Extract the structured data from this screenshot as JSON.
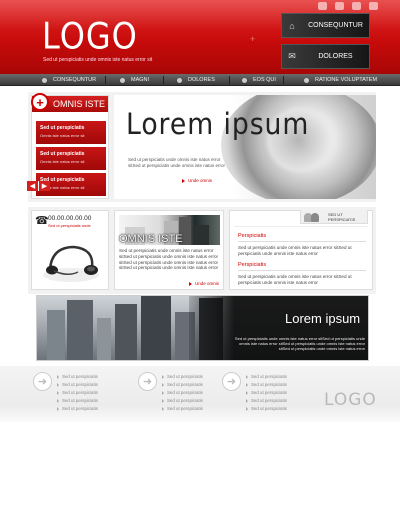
{
  "header": {
    "logo": "LOGO",
    "tagline": "Sed ut perspiciatis unde omnis iste natus error sit",
    "buttons": [
      {
        "label": "CONSEQUNTUR",
        "icon": "home-icon"
      },
      {
        "label": "DOLORES",
        "icon": "mail-icon"
      }
    ],
    "social_icons": [
      "share-icon",
      "rss-icon",
      "twitter-icon",
      "facebook-icon"
    ]
  },
  "nav": {
    "items": [
      "CONSEQUNTUR",
      "MAGNI",
      "DOLORES",
      "EOS QUI",
      "RATIONE VOLUPTATEM"
    ]
  },
  "sidebar_box": {
    "title": "OMNIS ISTE",
    "items": [
      {
        "title": "Sed ut perspiciatis",
        "sub": "Omnis iste natus error sit"
      },
      {
        "title": "Sed ut perspiciatis",
        "sub": "Omnis iste natus error sit"
      },
      {
        "title": "Sed ut perspiciatis",
        "sub": "Omnis iste natus error sit"
      }
    ]
  },
  "hero": {
    "title": "Lorem ipsum",
    "text": "Sed ut perspiciatis unde omnis iste natus error sitSed ut perspiciatis unde omnis iste natus error",
    "more": "Unde omnis"
  },
  "contact": {
    "phone": "00.00.00.00.00",
    "sub": "Sed ut perspiciatis unde"
  },
  "card2": {
    "title": "OMNIS ISTE",
    "text": "Sed ut perspiciatis unde omnis iste natus error sitSed ut perspiciatis unde omnis iste natus error sitSed ut perspiciatis unde omnis iste natus error sitSed ut perspiciatis unde omnis iste natus error",
    "more": "Unde omnis"
  },
  "card3": {
    "tab": "SED UT PERSPICIATIS",
    "sections": [
      {
        "heading": "Perspiciatis",
        "text": "Sed ut perspiciatis unde omnis iste natus error sitSed ut perspiciatis unde omnis iste natus error"
      },
      {
        "heading": "Perspiciatis",
        "text": "Sed ut perspiciatis unde omnis iste natus error sitSed ut perspiciatis unde omnis iste natus error"
      }
    ]
  },
  "banner": {
    "title": "Lorem ipsum",
    "text": "Sed ut perspiciatis unde omnis iste natus error sitSed ut perspiciatis unde omnis iste natus error sitSed ut perspiciatis unde omnis iste natus error sitSed ut perspiciatis unde omnis iste natus error"
  },
  "footer": {
    "link_label": "Sed ut perspiciatis",
    "logo": "LOGO"
  }
}
